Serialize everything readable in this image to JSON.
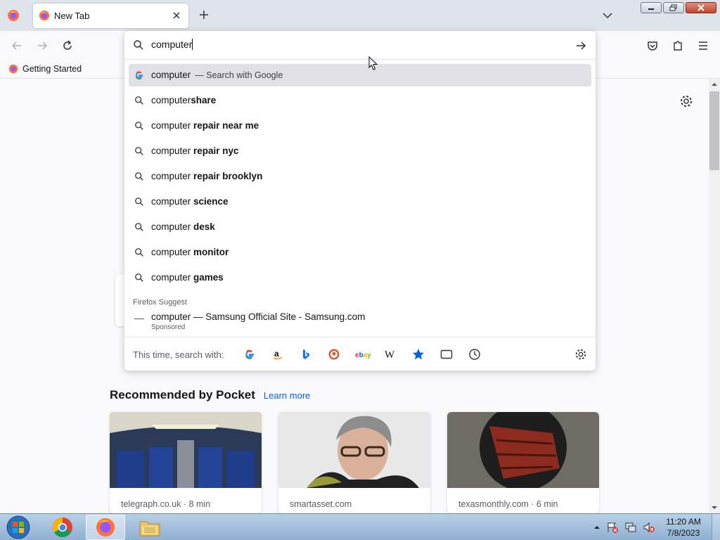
{
  "colors": {
    "accent": "#0061e0",
    "tabstrip_bg": "#dfe3ea",
    "active_result_bg": "#e0e0e6",
    "taskbar_bg": "#a8c4e0"
  },
  "window": {
    "tab": {
      "title": "New Tab",
      "icon": "firefox-icon",
      "close_icon": "close-icon"
    },
    "new_tab_icon": "plus-icon",
    "tab_list_icon": "chevron-down-icon",
    "controls": [
      "minimize-icon",
      "restore-icon",
      "close-icon"
    ]
  },
  "toolbar": {
    "back_icon": "arrow-left-icon",
    "forward_icon": "arrow-right-icon",
    "reload_icon": "reload-icon",
    "pocket_icon": "pocket-icon",
    "extensions_icon": "puzzle-icon",
    "menu_icon": "hamburger-icon"
  },
  "bookmarks": [
    {
      "label": "Getting Started",
      "icon": "firefox-icon"
    }
  ],
  "urlbar": {
    "value": "computer",
    "go_icon": "arrow-right-icon",
    "results": [
      {
        "typed": "computer",
        "rest": "",
        "extra": "— Search with Google",
        "icon": "google-icon",
        "active": true
      },
      {
        "typed": "computer",
        "rest": "share",
        "extra": "",
        "icon": "search-icon",
        "active": false
      },
      {
        "typed": "computer",
        "rest": " repair near me",
        "extra": "",
        "icon": "search-icon",
        "active": false
      },
      {
        "typed": "computer",
        "rest": " repair nyc",
        "extra": "",
        "icon": "search-icon",
        "active": false
      },
      {
        "typed": "computer",
        "rest": " repair brooklyn",
        "extra": "",
        "icon": "search-icon",
        "active": false
      },
      {
        "typed": "computer",
        "rest": " science",
        "extra": "",
        "icon": "search-icon",
        "active": false
      },
      {
        "typed": "computer",
        "rest": " desk",
        "extra": "",
        "icon": "search-icon",
        "active": false
      },
      {
        "typed": "computer",
        "rest": " monitor",
        "extra": "",
        "icon": "search-icon",
        "active": false
      },
      {
        "typed": "computer",
        "rest": " games",
        "extra": "",
        "icon": "search-icon",
        "active": false
      }
    ],
    "suggest_label": "Firefox Suggest",
    "sponsored": {
      "text": "computer — Samsung Official Site - Samsung.com",
      "tag": "Sponsored"
    },
    "oneoff_label": "This time, search with:",
    "engines": [
      "google-icon",
      "amazon-icon",
      "bing-icon",
      "duckduckgo-icon",
      "ebay-icon",
      "wikipedia-icon",
      "bookmarks-star-icon",
      "tabs-icon",
      "history-icon"
    ],
    "settings_icon": "gear-icon"
  },
  "page": {
    "settings_icon": "gear-icon",
    "pocket": {
      "title": "Recommended by Pocket",
      "learn_more": "Learn more",
      "cards": [
        {
          "source": "telegraph.co.uk · 8 min",
          "image": "airplane-cabin-photo"
        },
        {
          "source": "smartasset.com",
          "image": "woman-portrait-photo"
        },
        {
          "source": "texasmonthly.com · 6 min",
          "image": "grilled-steak-photo"
        }
      ]
    }
  },
  "taskbar": {
    "apps": [
      "chrome-icon",
      "firefox-icon",
      "file-explorer-icon"
    ],
    "active_app": "firefox-icon",
    "tray_icons": [
      "show-hidden-icons-icon",
      "action-center-icon",
      "network-icon",
      "volume-muted-icon"
    ],
    "time": "11:20 AM",
    "date": "7/8/2023"
  }
}
